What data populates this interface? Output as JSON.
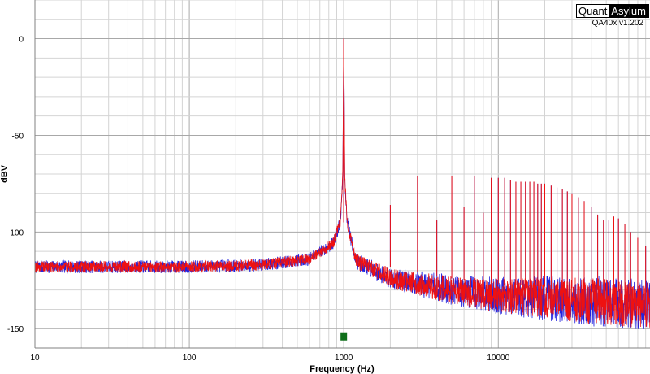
{
  "brand": {
    "quant": "Quant",
    "asylum": "Asylum",
    "version": "QA40x v1.202"
  },
  "chart_data": {
    "type": "line",
    "xlabel": "Frequency (Hz)",
    "ylabel": "dBV",
    "xscale": "log",
    "xlim": [
      10,
      96000
    ],
    "ylim": [
      -160,
      20
    ],
    "xticks": [
      10,
      100,
      1000,
      10000
    ],
    "xtick_labels": [
      "10",
      "100",
      "1000",
      "10000"
    ],
    "yticks": [
      0,
      -50,
      -100,
      -150
    ],
    "ytick_labels": [
      "0",
      "-50",
      "-100",
      "-150"
    ],
    "grid": true,
    "noise_floor_dbv": [
      {
        "x": 10,
        "y": -118
      },
      {
        "x": 100,
        "y": -118
      },
      {
        "x": 300,
        "y": -117
      },
      {
        "x": 600,
        "y": -114
      },
      {
        "x": 850,
        "y": -106
      },
      {
        "x": 950,
        "y": -95
      },
      {
        "x": 985,
        "y": -72
      },
      {
        "x": 1000,
        "y": 0
      },
      {
        "x": 1015,
        "y": -72
      },
      {
        "x": 1050,
        "y": -95
      },
      {
        "x": 1200,
        "y": -115
      },
      {
        "x": 2000,
        "y": -124
      },
      {
        "x": 5000,
        "y": -130
      },
      {
        "x": 10000,
        "y": -133
      },
      {
        "x": 30000,
        "y": -135
      },
      {
        "x": 96000,
        "y": -138
      }
    ],
    "harmonics_hz_dbv": [
      [
        2000,
        -86
      ],
      [
        3000,
        -71
      ],
      [
        4000,
        -94
      ],
      [
        5000,
        -71
      ],
      [
        6000,
        -87
      ],
      [
        7000,
        -71
      ],
      [
        8000,
        -90
      ],
      [
        9000,
        -72
      ],
      [
        10000,
        -72
      ],
      [
        11000,
        -72
      ],
      [
        12000,
        -73
      ],
      [
        13000,
        -74
      ],
      [
        14000,
        -74
      ],
      [
        15000,
        -74
      ],
      [
        16000,
        -74
      ],
      [
        17000,
        -74
      ],
      [
        18000,
        -75
      ],
      [
        19000,
        -75
      ],
      [
        20000,
        -75
      ],
      [
        22000,
        -76
      ],
      [
        24000,
        -77
      ],
      [
        26000,
        -78
      ],
      [
        28000,
        -79
      ],
      [
        30000,
        -80
      ],
      [
        33000,
        -82
      ],
      [
        36000,
        -84
      ],
      [
        40000,
        -87
      ],
      [
        44000,
        -91
      ],
      [
        48000,
        -94
      ],
      [
        52000,
        -94
      ],
      [
        56000,
        -92
      ],
      [
        60000,
        -93
      ],
      [
        66000,
        -96
      ],
      [
        72000,
        -100
      ],
      [
        80000,
        -103
      ],
      [
        90000,
        -107
      ]
    ],
    "series": [
      {
        "color": "#2222dd"
      },
      {
        "color": "#ee1111"
      }
    ],
    "marker": {
      "x": 1000,
      "y": -154,
      "color": "#0f6f1a"
    }
  }
}
